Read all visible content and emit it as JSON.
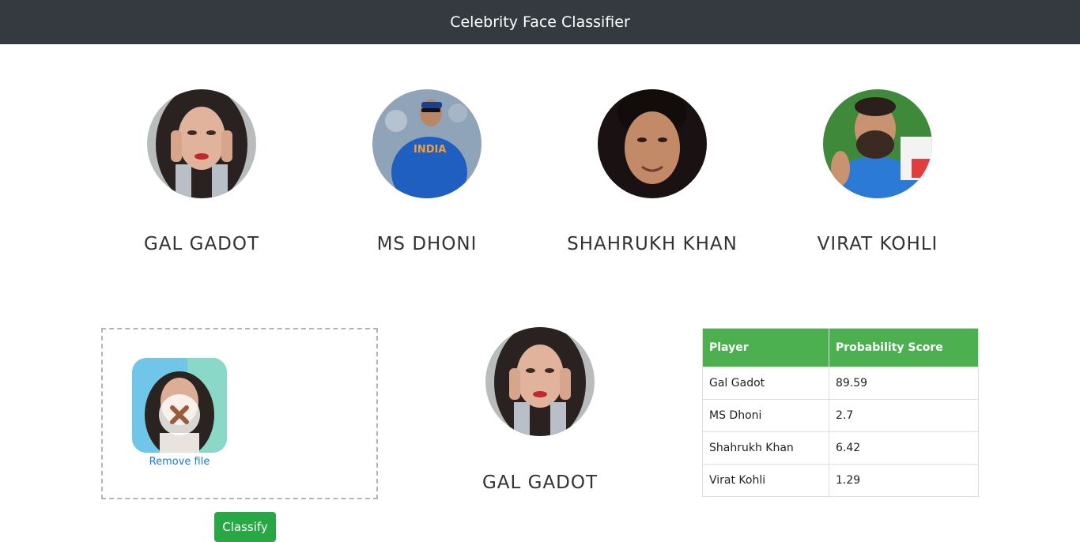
{
  "navbar": {
    "title": "Celebrity Face Classifier"
  },
  "celebrities": [
    {
      "name": "GAL GADOT"
    },
    {
      "name": "MS DHONI"
    },
    {
      "name": "SHAHRUKH KHAN"
    },
    {
      "name": "VIRAT KOHLI"
    }
  ],
  "upload": {
    "remove_label": "Remove file"
  },
  "classify_button": {
    "label": "Classify"
  },
  "result": {
    "name": "GAL GADOT"
  },
  "score_table": {
    "headers": [
      "Player",
      "Probability Score"
    ],
    "rows": [
      {
        "player": "Gal Gadot",
        "score": "89.59"
      },
      {
        "player": "MS Dhoni",
        "score": "2.7"
      },
      {
        "player": "Shahrukh Khan",
        "score": "6.42"
      },
      {
        "player": "Virat Kohli",
        "score": "1.29"
      }
    ]
  },
  "colors": {
    "navbar_bg": "#343a40",
    "table_header_bg": "#4caf50",
    "classify_button_bg": "#28a745",
    "link": "#1a7bd6"
  }
}
